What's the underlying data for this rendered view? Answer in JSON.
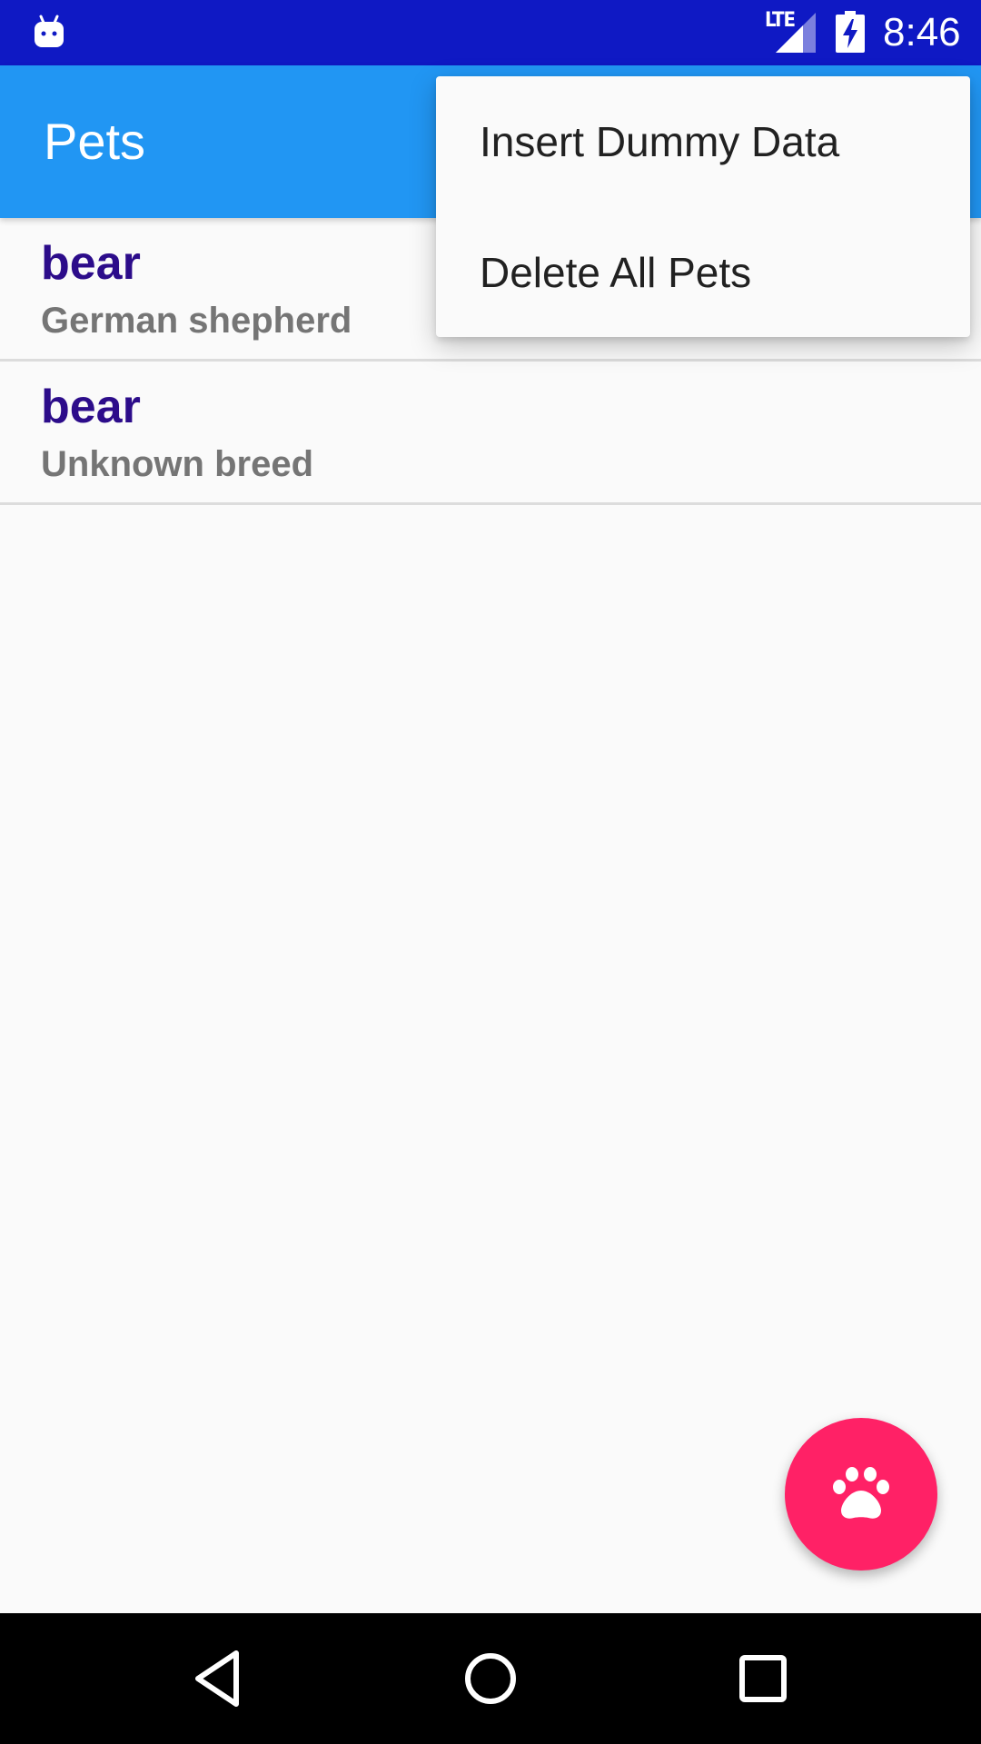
{
  "status_bar": {
    "network_label": "LTE",
    "time": "8:46",
    "icons": [
      "android-debug-icon",
      "signal-icon",
      "battery-charging-icon"
    ],
    "background_color": "#0F19C4"
  },
  "app_bar": {
    "title": "Pets",
    "background_color": "#2196F3"
  },
  "overflow_menu": {
    "items": [
      {
        "label": "Insert Dummy Data"
      },
      {
        "label": "Delete All Pets"
      }
    ]
  },
  "pets": [
    {
      "name": "bear",
      "breed": "German shepherd"
    },
    {
      "name": "bear",
      "breed": "Unknown breed"
    }
  ],
  "fab": {
    "icon": "paw-icon",
    "color": "#FF2166"
  },
  "nav_bar": {
    "icons": [
      "back-icon",
      "home-icon",
      "recents-icon"
    ]
  }
}
